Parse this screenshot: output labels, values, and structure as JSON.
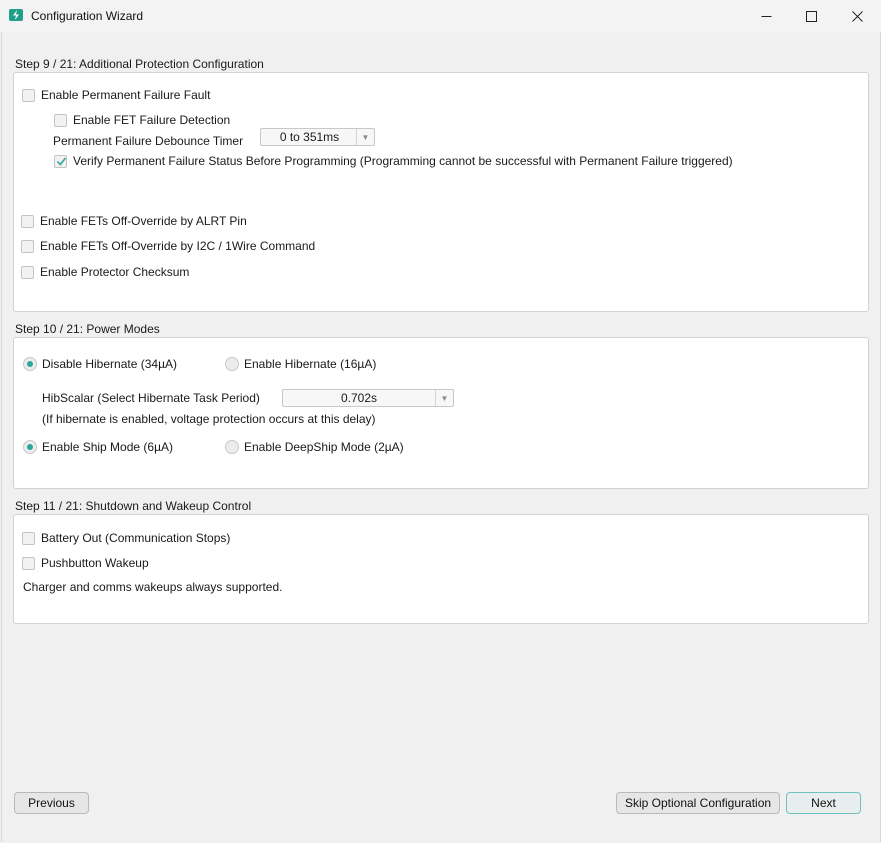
{
  "window": {
    "title": "Configuration Wizard",
    "minimize_icon": "minimize-icon",
    "maximize_icon": "maximize-icon",
    "close_icon": "close-icon"
  },
  "step9": {
    "heading": "Step 9 / 21: Additional Protection Configuration",
    "permanent_failure_fault": {
      "label": "Enable Permanent Failure Fault",
      "checked": false
    },
    "fet_failure_detection": {
      "label": "Enable FET Failure Detection",
      "checked": false
    },
    "debounce_timer": {
      "label": "Permanent Failure Debounce Timer",
      "value": "0 to 351ms"
    },
    "verify_pf_status": {
      "label": "Verify Permanent Failure Status Before Programming (Programming cannot be successful with Permanent Failure triggered)",
      "checked": true
    },
    "fets_off_alrt": {
      "label": "Enable FETs Off-Override by ALRT Pin",
      "checked": false
    },
    "fets_off_i2c": {
      "label": "Enable FETs Off-Override by I2C / 1Wire Command",
      "checked": false
    },
    "protector_checksum": {
      "label": "Enable Protector Checksum",
      "checked": false
    }
  },
  "step10": {
    "heading": "Step 10 / 21: Power Modes",
    "disable_hibernate": {
      "label": "Disable Hibernate (34µA)",
      "selected": true
    },
    "enable_hibernate": {
      "label": "Enable Hibernate (16µA)",
      "selected": false
    },
    "hibscalar": {
      "label": "HibScalar (Select Hibernate Task Period)",
      "value": "0.702s"
    },
    "hibscalar_note": "(If hibernate is enabled, voltage protection occurs at this delay)",
    "ship_mode": {
      "label": "Enable Ship Mode (6µA)",
      "selected": true
    },
    "deepship_mode": {
      "label": "Enable DeepShip Mode (2µA)",
      "selected": false
    }
  },
  "step11": {
    "heading": "Step 11 / 21: Shutdown and Wakeup Control",
    "battery_out": {
      "label": "Battery Out (Communication Stops)",
      "checked": false
    },
    "pushbutton_wakeup": {
      "label": "Pushbutton Wakeup",
      "checked": false
    },
    "note": "Charger and comms wakeups always supported."
  },
  "footer": {
    "previous_label": "Previous",
    "skip_label": "Skip Optional Configuration",
    "next_label": "Next"
  },
  "colors": {
    "accent": "#2aa79a",
    "panel_bg": "#ffffff",
    "window_bg": "#f0f0f0"
  }
}
